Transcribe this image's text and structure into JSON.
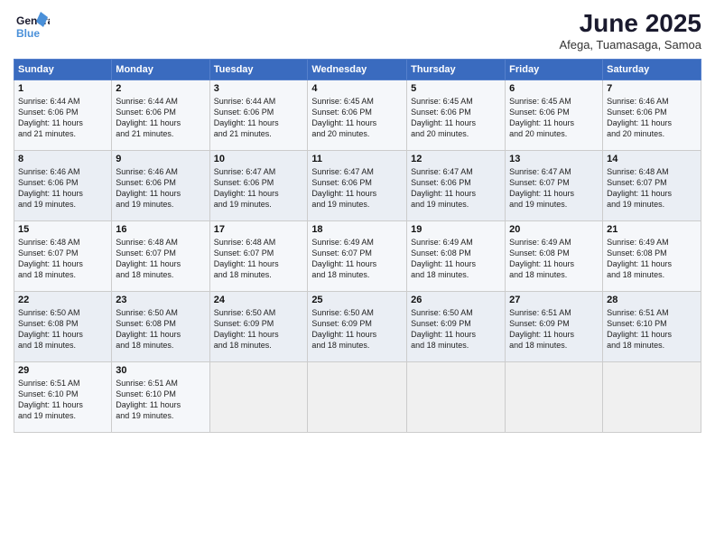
{
  "header": {
    "logo_line1": "General",
    "logo_line2": "Blue",
    "month": "June 2025",
    "location": "Afega, Tuamasaga, Samoa"
  },
  "weekdays": [
    "Sunday",
    "Monday",
    "Tuesday",
    "Wednesday",
    "Thursday",
    "Friday",
    "Saturday"
  ],
  "weeks": [
    [
      {
        "day": "1",
        "info": "Sunrise: 6:44 AM\nSunset: 6:06 PM\nDaylight: 11 hours\nand 21 minutes."
      },
      {
        "day": "2",
        "info": "Sunrise: 6:44 AM\nSunset: 6:06 PM\nDaylight: 11 hours\nand 21 minutes."
      },
      {
        "day": "3",
        "info": "Sunrise: 6:44 AM\nSunset: 6:06 PM\nDaylight: 11 hours\nand 21 minutes."
      },
      {
        "day": "4",
        "info": "Sunrise: 6:45 AM\nSunset: 6:06 PM\nDaylight: 11 hours\nand 20 minutes."
      },
      {
        "day": "5",
        "info": "Sunrise: 6:45 AM\nSunset: 6:06 PM\nDaylight: 11 hours\nand 20 minutes."
      },
      {
        "day": "6",
        "info": "Sunrise: 6:45 AM\nSunset: 6:06 PM\nDaylight: 11 hours\nand 20 minutes."
      },
      {
        "day": "7",
        "info": "Sunrise: 6:46 AM\nSunset: 6:06 PM\nDaylight: 11 hours\nand 20 minutes."
      }
    ],
    [
      {
        "day": "8",
        "info": "Sunrise: 6:46 AM\nSunset: 6:06 PM\nDaylight: 11 hours\nand 19 minutes."
      },
      {
        "day": "9",
        "info": "Sunrise: 6:46 AM\nSunset: 6:06 PM\nDaylight: 11 hours\nand 19 minutes."
      },
      {
        "day": "10",
        "info": "Sunrise: 6:47 AM\nSunset: 6:06 PM\nDaylight: 11 hours\nand 19 minutes."
      },
      {
        "day": "11",
        "info": "Sunrise: 6:47 AM\nSunset: 6:06 PM\nDaylight: 11 hours\nand 19 minutes."
      },
      {
        "day": "12",
        "info": "Sunrise: 6:47 AM\nSunset: 6:06 PM\nDaylight: 11 hours\nand 19 minutes."
      },
      {
        "day": "13",
        "info": "Sunrise: 6:47 AM\nSunset: 6:07 PM\nDaylight: 11 hours\nand 19 minutes."
      },
      {
        "day": "14",
        "info": "Sunrise: 6:48 AM\nSunset: 6:07 PM\nDaylight: 11 hours\nand 19 minutes."
      }
    ],
    [
      {
        "day": "15",
        "info": "Sunrise: 6:48 AM\nSunset: 6:07 PM\nDaylight: 11 hours\nand 18 minutes."
      },
      {
        "day": "16",
        "info": "Sunrise: 6:48 AM\nSunset: 6:07 PM\nDaylight: 11 hours\nand 18 minutes."
      },
      {
        "day": "17",
        "info": "Sunrise: 6:48 AM\nSunset: 6:07 PM\nDaylight: 11 hours\nand 18 minutes."
      },
      {
        "day": "18",
        "info": "Sunrise: 6:49 AM\nSunset: 6:07 PM\nDaylight: 11 hours\nand 18 minutes."
      },
      {
        "day": "19",
        "info": "Sunrise: 6:49 AM\nSunset: 6:08 PM\nDaylight: 11 hours\nand 18 minutes."
      },
      {
        "day": "20",
        "info": "Sunrise: 6:49 AM\nSunset: 6:08 PM\nDaylight: 11 hours\nand 18 minutes."
      },
      {
        "day": "21",
        "info": "Sunrise: 6:49 AM\nSunset: 6:08 PM\nDaylight: 11 hours\nand 18 minutes."
      }
    ],
    [
      {
        "day": "22",
        "info": "Sunrise: 6:50 AM\nSunset: 6:08 PM\nDaylight: 11 hours\nand 18 minutes."
      },
      {
        "day": "23",
        "info": "Sunrise: 6:50 AM\nSunset: 6:08 PM\nDaylight: 11 hours\nand 18 minutes."
      },
      {
        "day": "24",
        "info": "Sunrise: 6:50 AM\nSunset: 6:09 PM\nDaylight: 11 hours\nand 18 minutes."
      },
      {
        "day": "25",
        "info": "Sunrise: 6:50 AM\nSunset: 6:09 PM\nDaylight: 11 hours\nand 18 minutes."
      },
      {
        "day": "26",
        "info": "Sunrise: 6:50 AM\nSunset: 6:09 PM\nDaylight: 11 hours\nand 18 minutes."
      },
      {
        "day": "27",
        "info": "Sunrise: 6:51 AM\nSunset: 6:09 PM\nDaylight: 11 hours\nand 18 minutes."
      },
      {
        "day": "28",
        "info": "Sunrise: 6:51 AM\nSunset: 6:10 PM\nDaylight: 11 hours\nand 18 minutes."
      }
    ],
    [
      {
        "day": "29",
        "info": "Sunrise: 6:51 AM\nSunset: 6:10 PM\nDaylight: 11 hours\nand 19 minutes."
      },
      {
        "day": "30",
        "info": "Sunrise: 6:51 AM\nSunset: 6:10 PM\nDaylight: 11 hours\nand 19 minutes."
      },
      {
        "day": "",
        "info": ""
      },
      {
        "day": "",
        "info": ""
      },
      {
        "day": "",
        "info": ""
      },
      {
        "day": "",
        "info": ""
      },
      {
        "day": "",
        "info": ""
      }
    ]
  ]
}
